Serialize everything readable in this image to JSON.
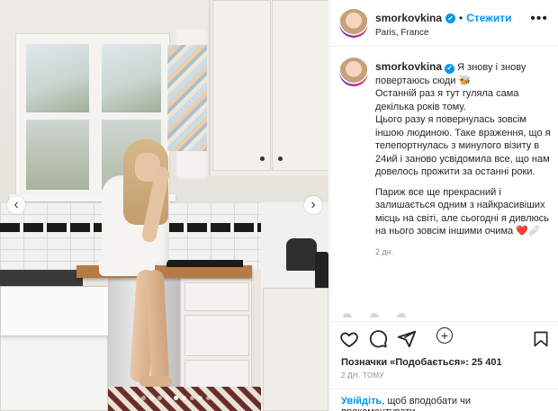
{
  "post": {
    "username": "smorkovkina",
    "follow_label": "Стежити",
    "location": "Paris, France",
    "more_label": "•••",
    "caption": {
      "line1": "Я знову і знову повертаюсь сюди 🐝",
      "line2": "Останній раз я тут гуляла сама декілька років тому.",
      "line3": "Цього разу я повернулась зовсім іншою людиною. Таке враження, що я телепортнулась з минулого візиту в 24ий і заново усвідомила все, що нам довелось прожити за останні роки.",
      "line4": "Париж все ще прекрасний і залишається одним з найкрасивіших місць на світі, але сьогодні я дивлюсь на нього зовсім іншими очима ❤️🩹",
      "time": "2 дн."
    },
    "likes_text": "Позначки «Подобається»: 25 401",
    "posted_ago": "2 ДН. ТОМУ",
    "login_link": "Увійдіть",
    "login_rest": ", щоб вподобати чи прокоментувати.",
    "carousel": {
      "total": 10,
      "current": 6
    }
  },
  "icons": {
    "verified": "verified-badge-icon",
    "prev": "chevron-left-icon",
    "next": "chevron-right-icon",
    "like": "heart-icon",
    "comment": "comment-icon",
    "share": "share-icon",
    "save": "bookmark-icon",
    "more": "more-icon",
    "load_more": "plus-circle-icon"
  },
  "colors": {
    "accent": "#0095f6",
    "text": "#262626",
    "muted": "#8e8e8e"
  }
}
